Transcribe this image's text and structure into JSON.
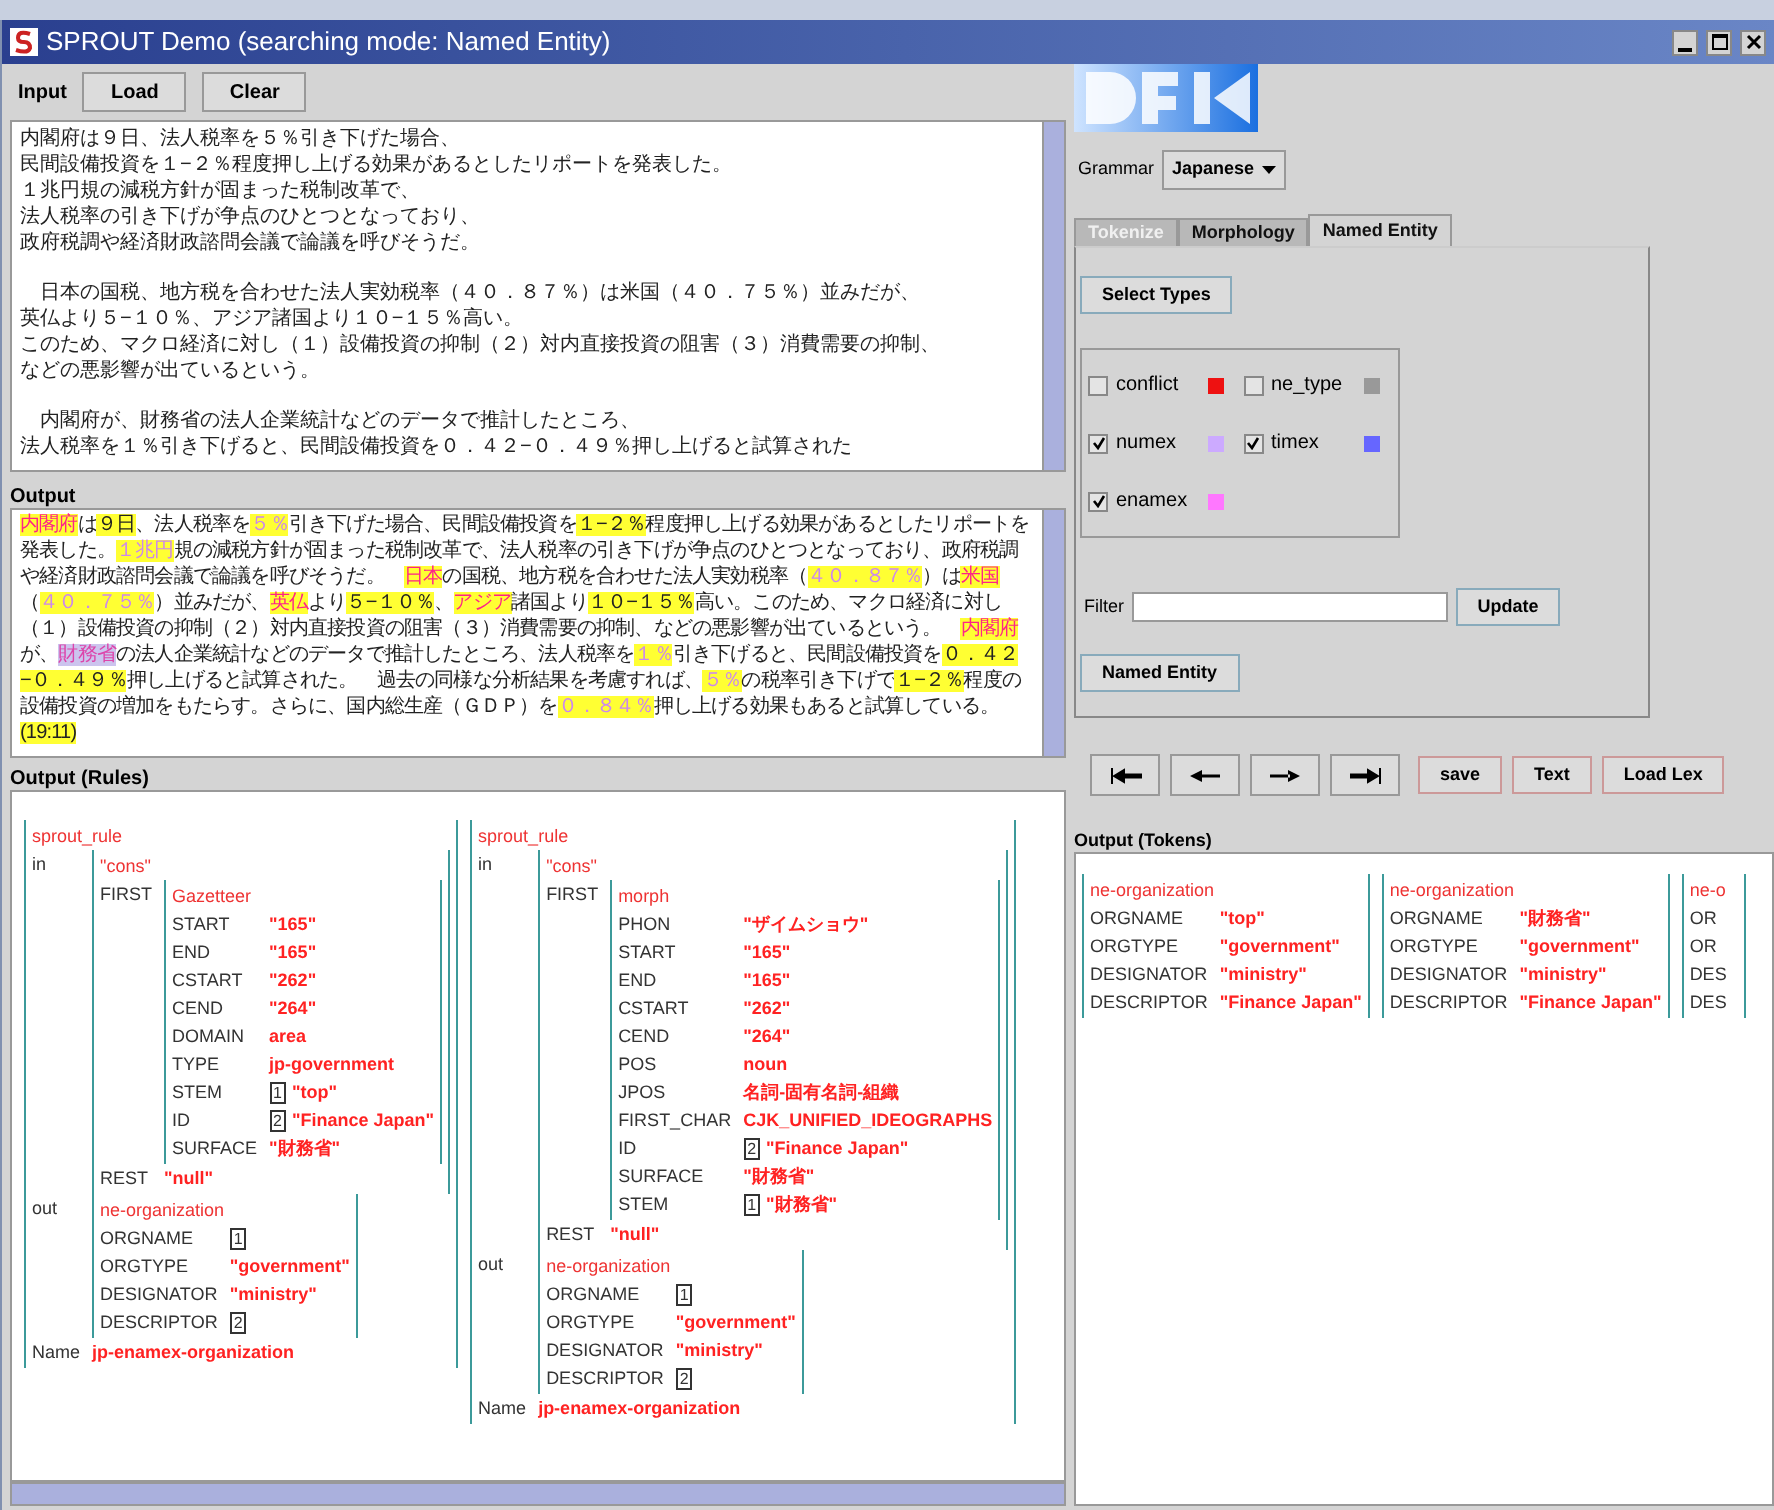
{
  "window": {
    "title": "SPROUT Demo (searching mode: Named Entity)"
  },
  "input": {
    "label": "Input",
    "buttons": [
      "Load",
      "Clear"
    ],
    "paragraphs": [
      [
        "内閣府は９日、法人税率を５％引き下げた場合、",
        "民間設備投資を１−２％程度押し上げる効果があるとしたリポートを発表した。",
        "１兆円規の減税方針が固まった税制改革で、",
        "法人税率の引き下げが争点のひとつとなっており、",
        "政府税調や経済財政諮問会議で論議を呼びそうだ。"
      ],
      [
        "　日本の国税、地方税を合わせた法人実効税率（４０．８７％）は米国（４０．７５％）並みだが、",
        "英仏より５−１０％、アジア諸国より１０−１５％高い。",
        "このため、マクロ経済に対し（１）設備投資の抑制（２）対内直接投資の阻害（３）消費需要の抑制、",
        "などの悪影響が出ているという。"
      ],
      [
        "　内閣府が、財務省の法人企業統計などのデータで推計したところ、",
        "法人税率を１％引き下げると、民間設備投資を０．４２−０．４９％押し上げると試算された"
      ]
    ]
  },
  "output": {
    "label": "Output",
    "segments": [
      {
        "text": "内閣府",
        "kind": "enamex"
      },
      {
        "text": "は",
        "kind": "plain"
      },
      {
        "text": "９日",
        "kind": "mark"
      },
      {
        "text": "、法人税率を",
        "kind": "plain"
      },
      {
        "text": "５％",
        "kind": "numex"
      },
      {
        "text": "引き下げた場合、民間設備投資を",
        "kind": "plain"
      },
      {
        "text": "１−２％",
        "kind": "mark"
      },
      {
        "text": "程度押し上げる効果があるとしたリポートを発表した。",
        "kind": "plain"
      },
      {
        "text": "１兆円",
        "kind": "numex"
      },
      {
        "text": "規の減税方針が固まった税制改革で、法人税率の引き下げが争点のひとつとなっており、政府税調や経済財政諮問会議で論議を呼びそうだ。　",
        "kind": "plain"
      },
      {
        "text": "日本",
        "kind": "enamex"
      },
      {
        "text": "の国税、地方税を合わせた法人実効税率（",
        "kind": "plain"
      },
      {
        "text": "４０．８７％",
        "kind": "numex"
      },
      {
        "text": "）は",
        "kind": "plain"
      },
      {
        "text": "米国",
        "kind": "enamex"
      },
      {
        "text": "（",
        "kind": "plain"
      },
      {
        "text": "４０．７５％",
        "kind": "numex"
      },
      {
        "text": "）並みだが、",
        "kind": "plain"
      },
      {
        "text": "英仏",
        "kind": "enamex"
      },
      {
        "text": "より",
        "kind": "plain"
      },
      {
        "text": "５−１０％",
        "kind": "mark"
      },
      {
        "text": "、",
        "kind": "plain"
      },
      {
        "text": "アジア",
        "kind": "enamex"
      },
      {
        "text": "諸国より",
        "kind": "plain"
      },
      {
        "text": "１０−１５％",
        "kind": "mark"
      },
      {
        "text": "高い。このため、マクロ経済に対し（１）設備投資の抑制（２）対内直接投資の阻害（３）消費需要の抑制、などの悪影響が出ているという。　",
        "kind": "plain"
      },
      {
        "text": "内閣府",
        "kind": "enamex"
      },
      {
        "text": "が、",
        "kind": "plain"
      },
      {
        "text": "財務省",
        "kind": "organization"
      },
      {
        "text": "の法人企業統計などのデータで推計したところ、法人税率を",
        "kind": "plain"
      },
      {
        "text": "１％",
        "kind": "numex"
      },
      {
        "text": "引き下げると、民間設備投資を",
        "kind": "plain"
      },
      {
        "text": "０．４２−０．４９％",
        "kind": "mark"
      },
      {
        "text": "押し上げると試算された。　過去の同様な分析結果を考慮すれば、",
        "kind": "plain"
      },
      {
        "text": "５％",
        "kind": "numex"
      },
      {
        "text": "の税率引き下げで",
        "kind": "plain"
      },
      {
        "text": "１−２％",
        "kind": "mark"
      },
      {
        "text": "程度の設備投資の増加をもたらす。さらに、国内総生産（ＧＤＰ）を",
        "kind": "plain"
      },
      {
        "text": "０．８４％",
        "kind": "numex"
      },
      {
        "text": "押し上げる効果もあると試算している。",
        "kind": "plain"
      },
      {
        "text": "(19:11)",
        "kind": "mark"
      }
    ]
  },
  "rules": {
    "label": "Output (Rules)",
    "items": [
      {
        "type": "sprout_rule",
        "features": [
          {
            "name": "in",
            "avm": {
              "type": "\"cons\"",
              "features": [
                {
                  "name": "FIRST",
                  "avm": {
                    "type": "Gazetteer",
                    "features": [
                      {
                        "name": "START",
                        "value": "\"165\""
                      },
                      {
                        "name": "END",
                        "value": "\"165\""
                      },
                      {
                        "name": "CSTART",
                        "value": "\"262\""
                      },
                      {
                        "name": "CEND",
                        "value": "\"264\""
                      },
                      {
                        "name": "DOMAIN",
                        "value": "area"
                      },
                      {
                        "name": "TYPE",
                        "value": "jp-government"
                      },
                      {
                        "name": "STEM",
                        "tag": "1",
                        "value": "\"top\""
                      },
                      {
                        "name": "ID",
                        "tag": "2",
                        "value": "\"Finance Japan\""
                      },
                      {
                        "name": "SURFACE",
                        "value": "\"財務省\""
                      }
                    ]
                  }
                },
                {
                  "name": "REST",
                  "value": "\"null\""
                }
              ]
            }
          },
          {
            "name": "out",
            "avm": {
              "type": "ne-organization",
              "features": [
                {
                  "name": "ORGNAME",
                  "tag": "1"
                },
                {
                  "name": "ORGTYPE",
                  "value": "\"government\""
                },
                {
                  "name": "DESIGNATOR",
                  "value": "\"ministry\""
                },
                {
                  "name": "DESCRIPTOR",
                  "tag": "2"
                }
              ]
            }
          },
          {
            "name": "Name",
            "value": "jp-enamex-organization"
          }
        ]
      },
      {
        "type": "sprout_rule",
        "features": [
          {
            "name": "in",
            "avm": {
              "type": "\"cons\"",
              "features": [
                {
                  "name": "FIRST",
                  "avm": {
                    "type": "morph",
                    "features": [
                      {
                        "name": "PHON",
                        "value": "\"ザイムショウ\""
                      },
                      {
                        "name": "START",
                        "value": "\"165\""
                      },
                      {
                        "name": "END",
                        "value": "\"165\""
                      },
                      {
                        "name": "CSTART",
                        "value": "\"262\""
                      },
                      {
                        "name": "CEND",
                        "value": "\"264\""
                      },
                      {
                        "name": "POS",
                        "value": "noun"
                      },
                      {
                        "name": "JPOS",
                        "value": "名詞-固有名詞-組織"
                      },
                      {
                        "name": "FIRST_CHAR",
                        "value": "CJK_UNIFIED_IDEOGRAPHS"
                      },
                      {
                        "name": "ID",
                        "tag": "2",
                        "value": "\"Finance Japan\""
                      },
                      {
                        "name": "SURFACE",
                        "value": "\"財務省\""
                      },
                      {
                        "name": "STEM",
                        "tag": "1",
                        "value": "\"財務省\""
                      }
                    ]
                  }
                },
                {
                  "name": "REST",
                  "value": "\"null\""
                }
              ]
            }
          },
          {
            "name": "out",
            "avm": {
              "type": "ne-organization",
              "features": [
                {
                  "name": "ORGNAME",
                  "tag": "1"
                },
                {
                  "name": "ORGTYPE",
                  "value": "\"government\""
                },
                {
                  "name": "DESIGNATOR",
                  "value": "\"ministry\""
                },
                {
                  "name": "DESCRIPTOR",
                  "tag": "2"
                }
              ]
            }
          },
          {
            "name": "Name",
            "value": "jp-enamex-organization"
          }
        ]
      }
    ]
  },
  "grammar": {
    "label": "Grammar",
    "value": "Japanese"
  },
  "tabs": [
    {
      "label": "Tokenize",
      "selected": false,
      "disabled": true
    },
    {
      "label": "Morphology",
      "selected": false,
      "disabled": false
    },
    {
      "label": "Named Entity",
      "selected": true,
      "disabled": false
    }
  ],
  "select_types_button": "Select Types",
  "types": [
    {
      "label": "conflict",
      "checked": false,
      "color": "#ee1111"
    },
    {
      "label": "ne_type",
      "checked": false,
      "color": "#999999"
    },
    {
      "label": "numex",
      "checked": true,
      "color": "#ccaaff"
    },
    {
      "label": "timex",
      "checked": true,
      "color": "#6666ff"
    },
    {
      "label": "enamex",
      "checked": true,
      "color": "#ff77ff"
    }
  ],
  "filter": {
    "label": "Filter",
    "button": "Update"
  },
  "named_entity_button": "Named Entity",
  "action_buttons": [
    "save",
    "Text",
    "Load Lex"
  ],
  "tokens": {
    "label": "Output (Tokens)",
    "items": [
      {
        "type": "ne-organization",
        "features": [
          {
            "name": "ORGNAME",
            "value": "\"top\""
          },
          {
            "name": "ORGTYPE",
            "value": "\"government\""
          },
          {
            "name": "DESIGNATOR",
            "value": "\"ministry\""
          },
          {
            "name": "DESCRIPTOR",
            "value": "\"Finance Japan\""
          }
        ]
      },
      {
        "type": "ne-organization",
        "features": [
          {
            "name": "ORGNAME",
            "value": "\"財務省\""
          },
          {
            "name": "ORGTYPE",
            "value": "\"government\""
          },
          {
            "name": "DESIGNATOR",
            "value": "\"ministry\""
          },
          {
            "name": "DESCRIPTOR",
            "value": "\"Finance Japan\""
          }
        ]
      },
      {
        "type": "ne-o",
        "features": [
          {
            "name": "OR"
          },
          {
            "name": "OR"
          },
          {
            "name": "DES"
          },
          {
            "name": "DES"
          }
        ]
      }
    ]
  }
}
